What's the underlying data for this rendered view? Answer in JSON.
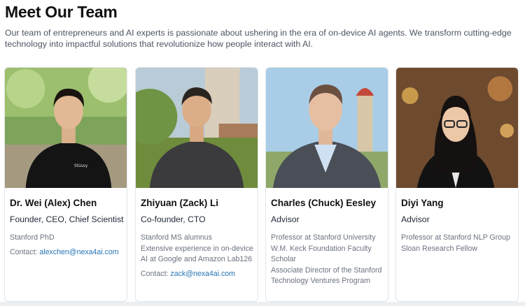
{
  "heading": "Meet Our Team",
  "intro": "Our team of entrepreneurs and AI experts is passionate about ushering in the era of on-device AI agents. We transform cutting-edge technology into impactful solutions that revolutionize how people interact with AI.",
  "members": [
    {
      "name": "Dr. Wei (Alex) Chen",
      "role": "Founder, CEO, Chief Scientist",
      "details": [
        "Stanford PhD"
      ],
      "contact_label": "Contact:",
      "email": "alexchen@nexa4ai.com"
    },
    {
      "name": "Zhiyuan (Zack) Li",
      "role": "Co-founder, CTO",
      "details": [
        "Stanford MS alumnus",
        "Extensive experience in on-device",
        "AI at Google and Amazon Lab126"
      ],
      "contact_label": "Contact:",
      "email": "zack@nexa4ai.com"
    },
    {
      "name": "Charles (Chuck) Eesley",
      "role": "Advisor",
      "details": [
        "Professor at Stanford University",
        "W.M. Keck Foundation Faculty",
        "Scholar",
        "Associate Director of the Stanford",
        "Technology Ventures Program"
      ]
    },
    {
      "name": "Diyi Yang",
      "role": "Advisor",
      "details": [
        "Professor at Stanford NLP Group",
        "Sloan Research Fellow"
      ]
    }
  ],
  "colors": {
    "email_link": "#2474b5",
    "card_border": "#e2e5ea"
  }
}
